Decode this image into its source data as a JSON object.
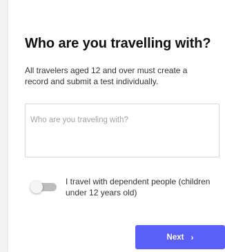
{
  "form": {
    "title": "Who are you travelling with?",
    "subtitle": "All travelers aged 12 and over must create a record and submit a test individually.",
    "companions_input": {
      "value": "",
      "placeholder": "Who are you traveling with?"
    },
    "dependents_toggle": {
      "label": "I travel with dependent people (children under 12 years old)",
      "checked": false
    },
    "next_button": {
      "label": "Next",
      "icon": "chevron-right-icon",
      "glyph": "›"
    }
  },
  "colors": {
    "accent": "#5a5ff7",
    "toggle_track_off": "#bdbdbd",
    "background": "#f3f3f3",
    "card": "#ffffff"
  }
}
